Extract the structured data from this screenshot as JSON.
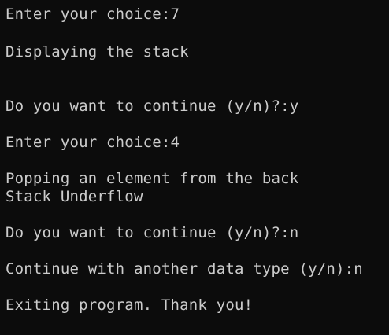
{
  "terminal": {
    "lines": [
      "Enter your choice:7",
      "Displaying the stack",
      "Do you want to continue (y/n)?:y",
      "Enter your choice:4",
      "Popping an element from the back",
      "Stack Underflow",
      "Do you want to continue (y/n)?:n",
      "Continue with another data type (y/n):n",
      "Exiting program. Thank you!"
    ],
    "colors": {
      "background": "#0c0c0c",
      "foreground": "#cccccc"
    }
  }
}
